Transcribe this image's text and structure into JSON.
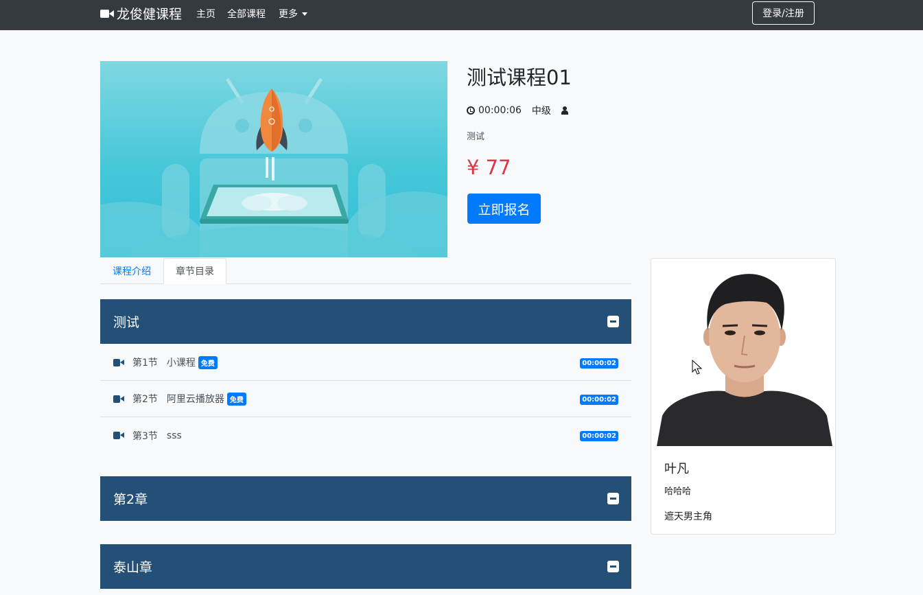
{
  "navbar": {
    "brand": "龙俊健课程",
    "links": {
      "home": "主页",
      "all_courses": "全部课程",
      "more": "更多"
    },
    "login": "登录/注册"
  },
  "course": {
    "title": "测试课程01",
    "duration": "00:00:06",
    "level": "中级",
    "description": "测试",
    "price": "¥ 77",
    "enroll_label": "立即报名"
  },
  "tabs": {
    "intro": "课程介绍",
    "chapters": "章节目录"
  },
  "chapters": [
    {
      "title": "测试",
      "lessons": [
        {
          "number": "第1节",
          "name": "小课程",
          "free_badge": "免费",
          "duration": "00:00:02"
        },
        {
          "number": "第2节",
          "name": "阿里云播放器",
          "free_badge": "免费",
          "duration": "00:00:02"
        },
        {
          "number": "第3节",
          "name": "sss",
          "duration": "00:00:02"
        }
      ]
    },
    {
      "title": "第2章"
    },
    {
      "title": "泰山章"
    }
  ],
  "teacher": {
    "name": "叶凡",
    "title": "哈哈哈",
    "description": "遮天男主角"
  },
  "colors": {
    "navbar": "#343a40",
    "primary": "#007bff",
    "chapter_header": "#245078",
    "price": "#dc3545"
  }
}
